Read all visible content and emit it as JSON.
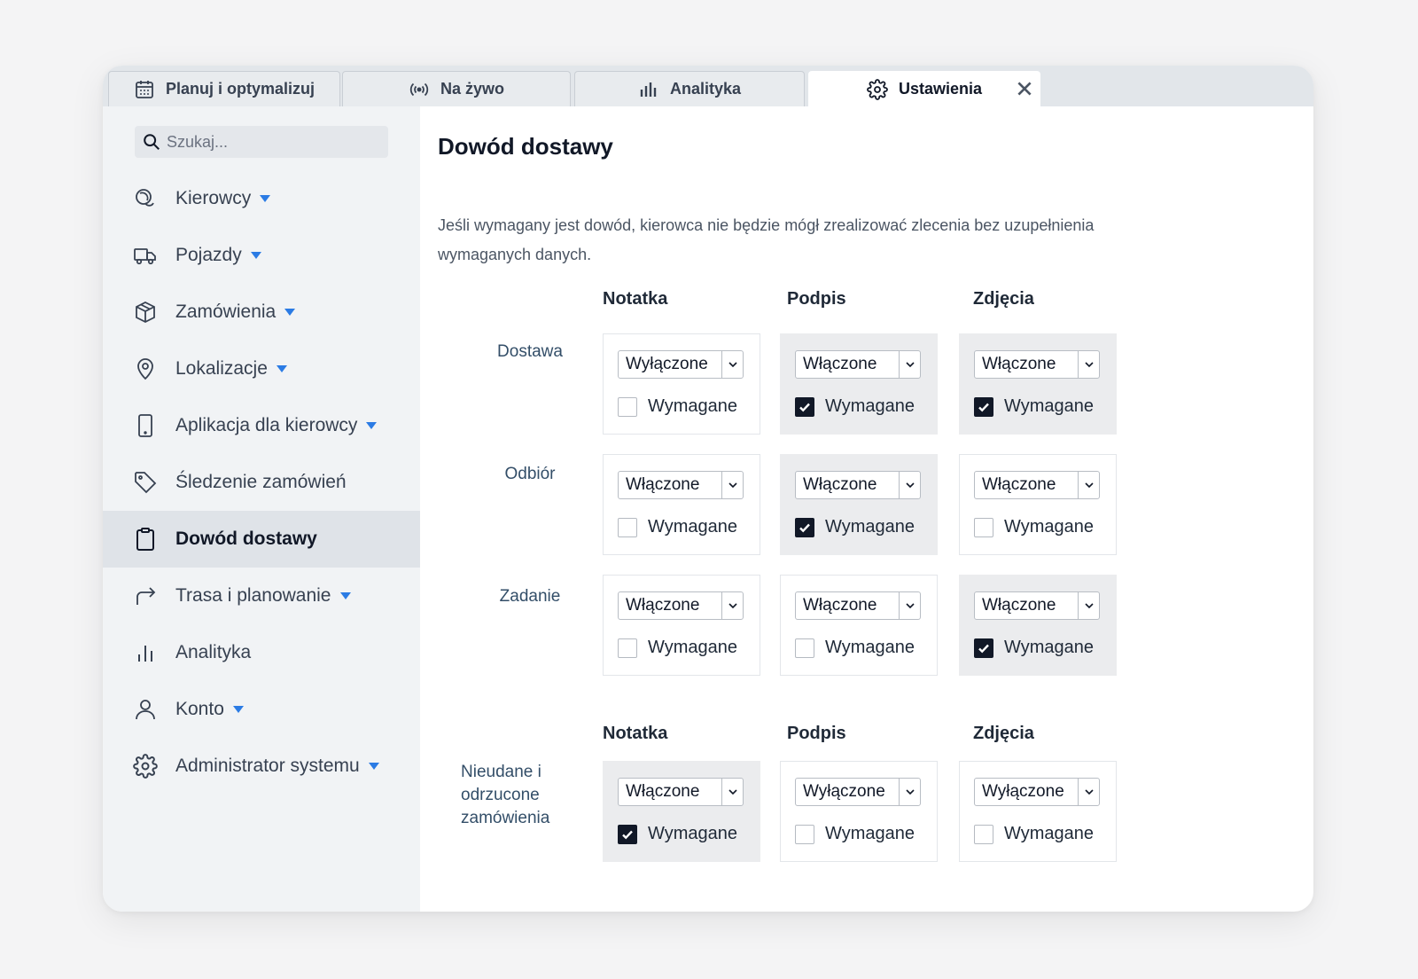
{
  "tabs": [
    {
      "label": "Planuj i optymalizuj",
      "icon": "calendar-icon"
    },
    {
      "label": "Na żywo",
      "icon": "broadcast-icon"
    },
    {
      "label": "Analityka",
      "icon": "bar-chart-icon"
    },
    {
      "label": "Ustawienia",
      "icon": "gear-icon",
      "active": true
    }
  ],
  "search": {
    "placeholder": "Szukaj..."
  },
  "sidebar": {
    "items": [
      {
        "label": "Kierowcy",
        "icon": "driver-icon",
        "caret": true
      },
      {
        "label": "Pojazdy",
        "icon": "truck-icon",
        "caret": true
      },
      {
        "label": "Zamówienia",
        "icon": "package-icon",
        "caret": true
      },
      {
        "label": "Lokalizacje",
        "icon": "location-pin-icon",
        "caret": true
      },
      {
        "label": "Aplikacja dla kierowcy",
        "icon": "phone-icon",
        "caret": true
      },
      {
        "label": "Śledzenie zamówień",
        "icon": "tag-icon",
        "caret": false
      },
      {
        "label": "Dowód dostawy",
        "icon": "clipboard-icon",
        "caret": false,
        "active": true
      },
      {
        "label": "Trasa i planowanie",
        "icon": "route-arrow-icon",
        "caret": true
      },
      {
        "label": "Analityka",
        "icon": "bar-chart-icon",
        "caret": false
      },
      {
        "label": "Konto",
        "icon": "user-icon",
        "caret": true
      },
      {
        "label": "Administrator systemu",
        "icon": "gear-icon",
        "caret": true
      }
    ]
  },
  "main": {
    "title": "Dowód dostawy",
    "description": "Jeśli wymagany jest dowód, kierowca nie będzie mógł zrealizować zlecenia bez uzupełnienia wymaganych danych.",
    "columns": [
      "Notatka",
      "Podpis",
      "Zdjęcia"
    ],
    "required_label": "Wymagane",
    "rows": [
      {
        "label": "Dostawa",
        "cells": [
          {
            "value": "Wyłączone",
            "required": false,
            "shaded": false
          },
          {
            "value": "Włączone",
            "required": true,
            "shaded": true
          },
          {
            "value": "Włączone",
            "required": true,
            "shaded": true
          }
        ]
      },
      {
        "label": "Odbiór",
        "cells": [
          {
            "value": "Włączone",
            "required": false,
            "shaded": false
          },
          {
            "value": "Włączone",
            "required": true,
            "shaded": true
          },
          {
            "value": "Włączone",
            "required": false,
            "shaded": false
          }
        ]
      },
      {
        "label": "Zadanie",
        "cells": [
          {
            "value": "Włączone",
            "required": false,
            "shaded": false
          },
          {
            "value": "Włączone",
            "required": false,
            "shaded": false
          },
          {
            "value": "Włączone",
            "required": true,
            "shaded": true
          }
        ]
      }
    ],
    "failed": {
      "label": "Nieudane i odrzucone zamówienia",
      "cells": [
        {
          "value": "Włączone",
          "required": true,
          "shaded": true
        },
        {
          "value": "Wyłączone",
          "required": false,
          "shaded": false
        },
        {
          "value": "Wyłączone",
          "required": false,
          "shaded": false
        }
      ]
    }
  },
  "colors": {
    "accent": "#2b7be4",
    "active_bg": "#dfe3e8",
    "checked": "#111827"
  }
}
